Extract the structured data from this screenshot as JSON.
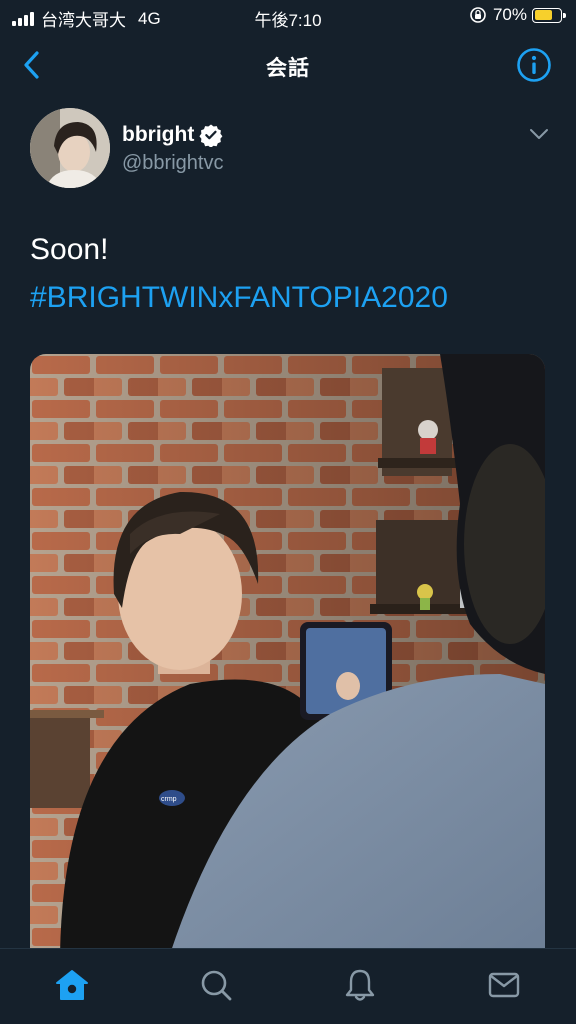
{
  "status_bar": {
    "carrier": "台湾大哥大",
    "network": "4G",
    "time": "午後7:10",
    "battery": "70%",
    "battery_level": 0.7,
    "battery_color": "#f7d02c"
  },
  "nav": {
    "title": "会話",
    "back_icon": "chevron-left-icon",
    "info_icon": "info-circle-icon"
  },
  "tweet": {
    "author_name": "bbright",
    "author_handle": "@bbrightvc",
    "verified": true,
    "text_line1": "Soon!",
    "hashtag": "#BRIGHTWINxFANTOPIA2020"
  },
  "tab_bar": {
    "tabs": [
      {
        "icon": "home-icon",
        "active": true
      },
      {
        "icon": "search-icon",
        "active": false
      },
      {
        "icon": "bell-icon",
        "active": false
      },
      {
        "icon": "mail-icon",
        "active": false
      }
    ]
  },
  "colors": {
    "background": "#15202b",
    "accent": "#1da1f2",
    "secondary_text": "#8899a6"
  }
}
